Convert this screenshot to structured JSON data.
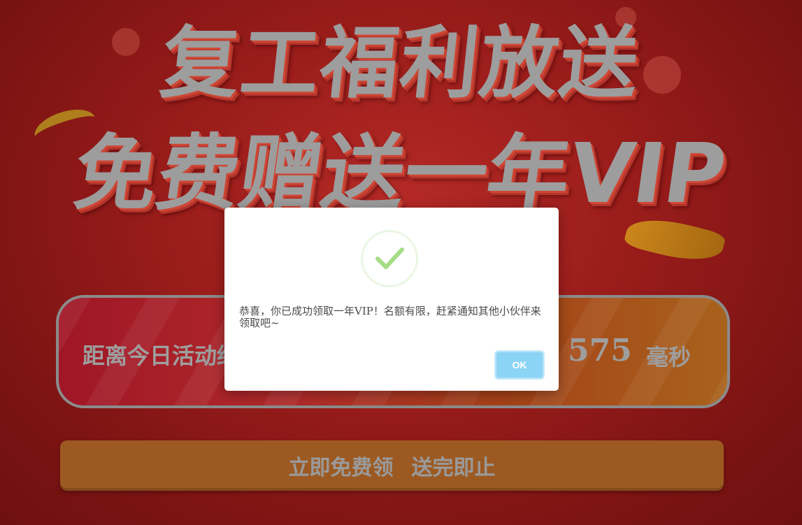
{
  "banner": {
    "headline_line1": "复工福利放送",
    "headline_line2": "免费赠送一年VIP"
  },
  "countdown": {
    "label": "距离今日活动结",
    "milliseconds_value": "575",
    "milliseconds_unit": "毫秒"
  },
  "claim_button": {
    "part1": "立即免费领",
    "part2": "送完即止"
  },
  "dialog": {
    "icon": "check-circle-icon",
    "message": "恭喜，你已成功领取一年VIP！名额有限，赶紧通知其他小伙伴来领取吧~",
    "ok_label": "OK"
  },
  "colors": {
    "background": "#9a1d1b",
    "headline_text": "#9d9d9d",
    "ok_button": "#8cd4f5",
    "check_stroke": "#a5dc86"
  }
}
